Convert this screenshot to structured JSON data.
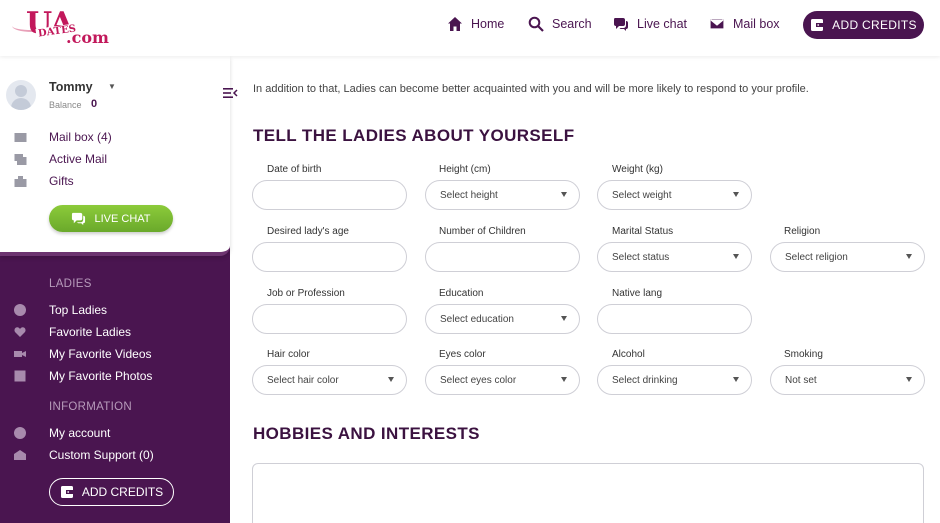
{
  "logo": {
    "top": "UA",
    "middle": "DATES",
    "suffix": ".com"
  },
  "nav": {
    "home": "Home",
    "search": "Search",
    "live_chat": "Live chat",
    "mail_box": "Mail box",
    "add_credits": "ADD CREDITS"
  },
  "user": {
    "name": "Tommy",
    "balance_label": "Balance",
    "balance": "0"
  },
  "sidebar": {
    "links": [
      "Mail box (4)",
      "Active Mail",
      "Gifts"
    ],
    "live_chat": "LIVE CHAT",
    "ladies_heading": "LADIES",
    "ladies_items": [
      "Top Ladies",
      "Favorite Ladies",
      "My Favorite Videos",
      "My Favorite Photos"
    ],
    "info_heading": "INFORMATION",
    "info_items": [
      "My account",
      "Custom Support (0)"
    ],
    "add_credits": "ADD CREDITS"
  },
  "main": {
    "intro": "In addition to that, Ladies can become better acquainted with you and will be more likely to respond to your profile.",
    "section_title": "TELL THE LADIES ABOUT YOURSELF",
    "hobbies_title": "HOBBIES AND INTERESTS",
    "fields": {
      "dob": {
        "label": "Date of birth",
        "value": ""
      },
      "height": {
        "label": "Height (cm)",
        "value": "Select height"
      },
      "weight": {
        "label": "Weight (kg)",
        "value": "Select weight"
      },
      "lady_age": {
        "label": "Desired lady's age",
        "value": ""
      },
      "children": {
        "label": "Number of Children",
        "value": ""
      },
      "marital": {
        "label": "Marital Status",
        "value": "Select status"
      },
      "religion": {
        "label": "Religion",
        "value": "Select religion"
      },
      "job": {
        "label": "Job or Profession",
        "value": ""
      },
      "education": {
        "label": "Education",
        "value": "Select education"
      },
      "native_lang": {
        "label": "Native lang",
        "value": ""
      },
      "hair": {
        "label": "Hair color",
        "value": "Select hair color"
      },
      "eyes": {
        "label": "Eyes color",
        "value": "Select eyes color"
      },
      "alcohol": {
        "label": "Alcohol",
        "value": "Select drinking"
      },
      "smoking": {
        "label": "Smoking",
        "value": "Not set"
      }
    }
  },
  "colors": {
    "brand": "#4a1550",
    "accent_green": "#7bbb33",
    "logo": "#c2185b"
  }
}
